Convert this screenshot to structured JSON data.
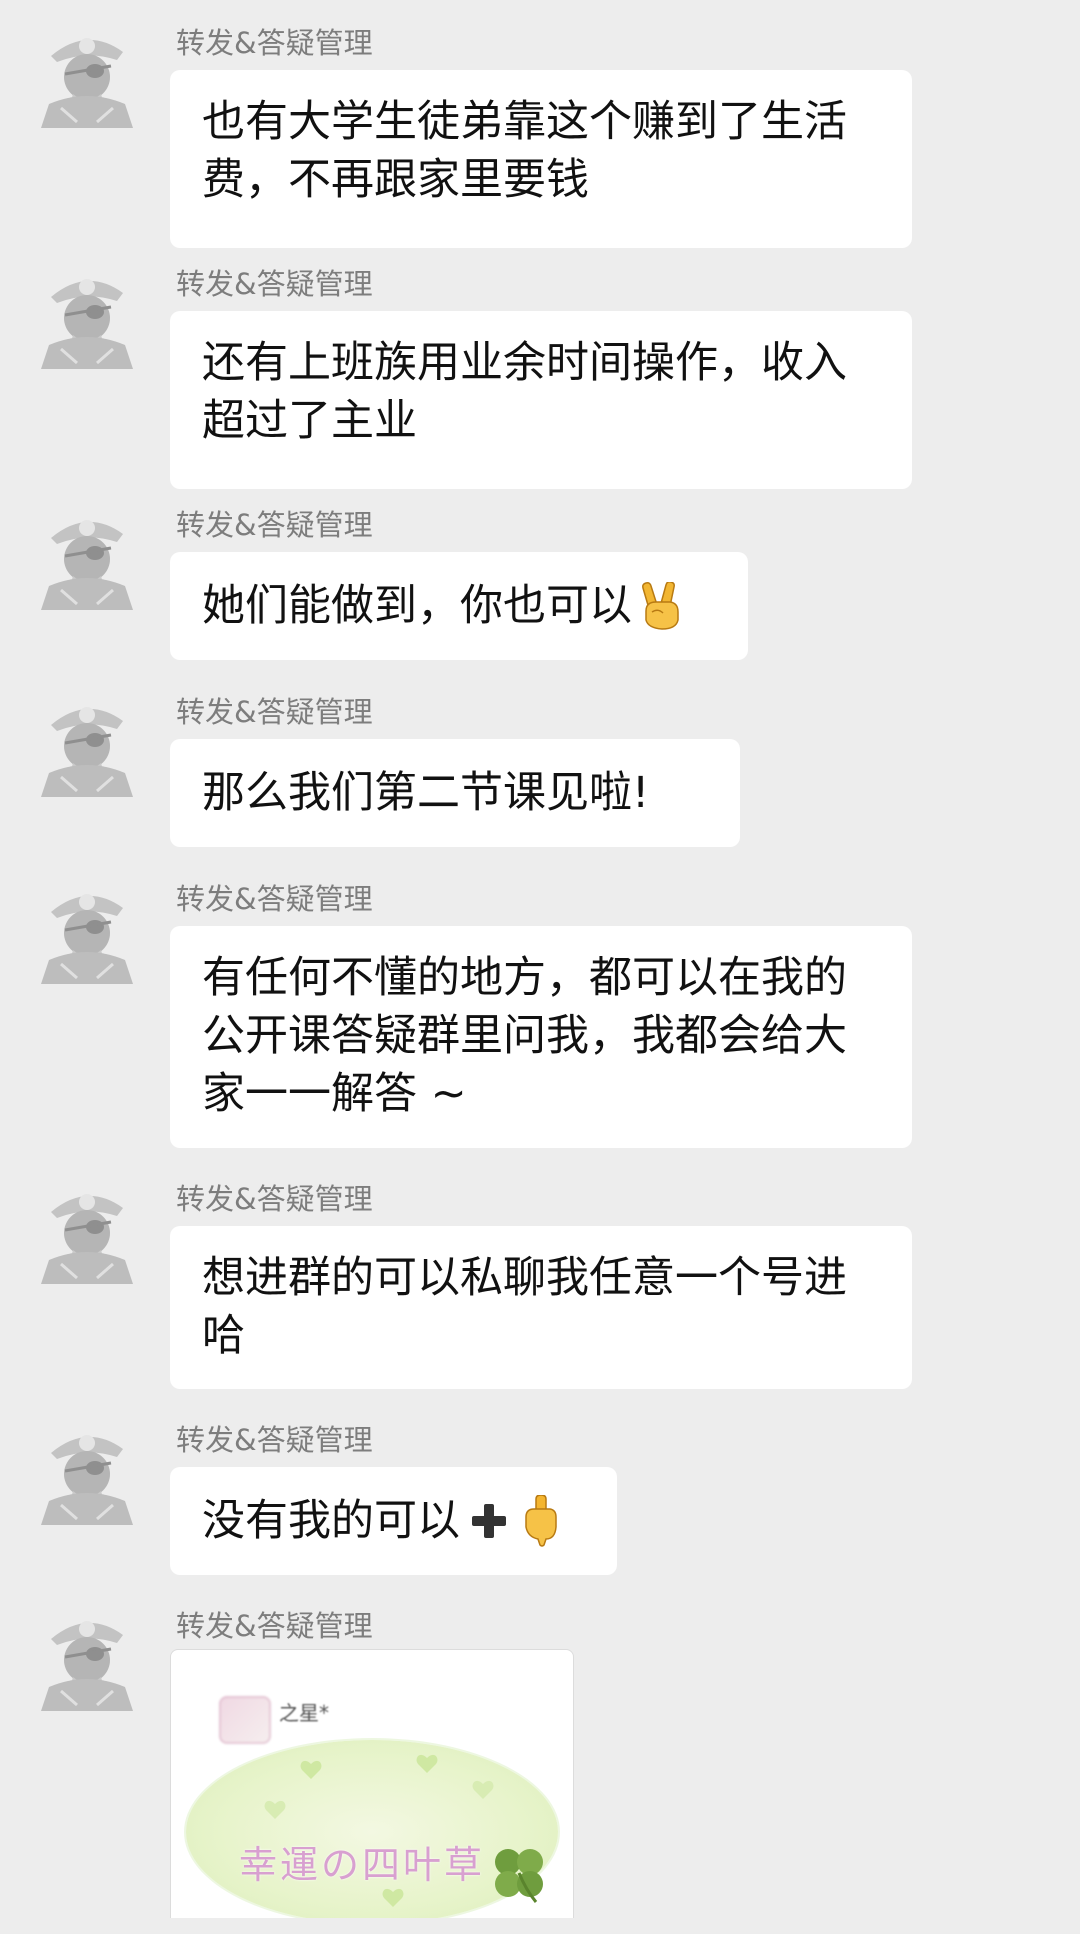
{
  "sender_name": "转发&答疑管理",
  "messages": [
    {
      "id": "m1",
      "text": "也有大学生徒弟靠这个赚到了生活\n费，不再跟家里要钱"
    },
    {
      "id": "m2",
      "text": "还有上班族用业余时间操作，收入\n超过了主业"
    },
    {
      "id": "m3",
      "text": "她们能做到，你也可以",
      "emoji": "victory-hand"
    },
    {
      "id": "m4",
      "text": "那么我们第二节课见啦!"
    },
    {
      "id": "m5",
      "text": "有任何不懂的地方，都可以在我的\n公开课答疑群里问我，我都会给大\n家一一解答 ~"
    },
    {
      "id": "m6",
      "text": "想进群的可以私聊我任意一个号进\n哈"
    },
    {
      "id": "m7",
      "text": "没有我的可以",
      "emoji": "plus-pointing-down"
    }
  ],
  "image_message": {
    "blurred_name": "之星*",
    "caption": "幸運の四叶草"
  },
  "colors": {
    "background": "#ededed",
    "bubble": "#ffffff",
    "sender_text": "#7d7d7d",
    "message_text": "#111111"
  }
}
